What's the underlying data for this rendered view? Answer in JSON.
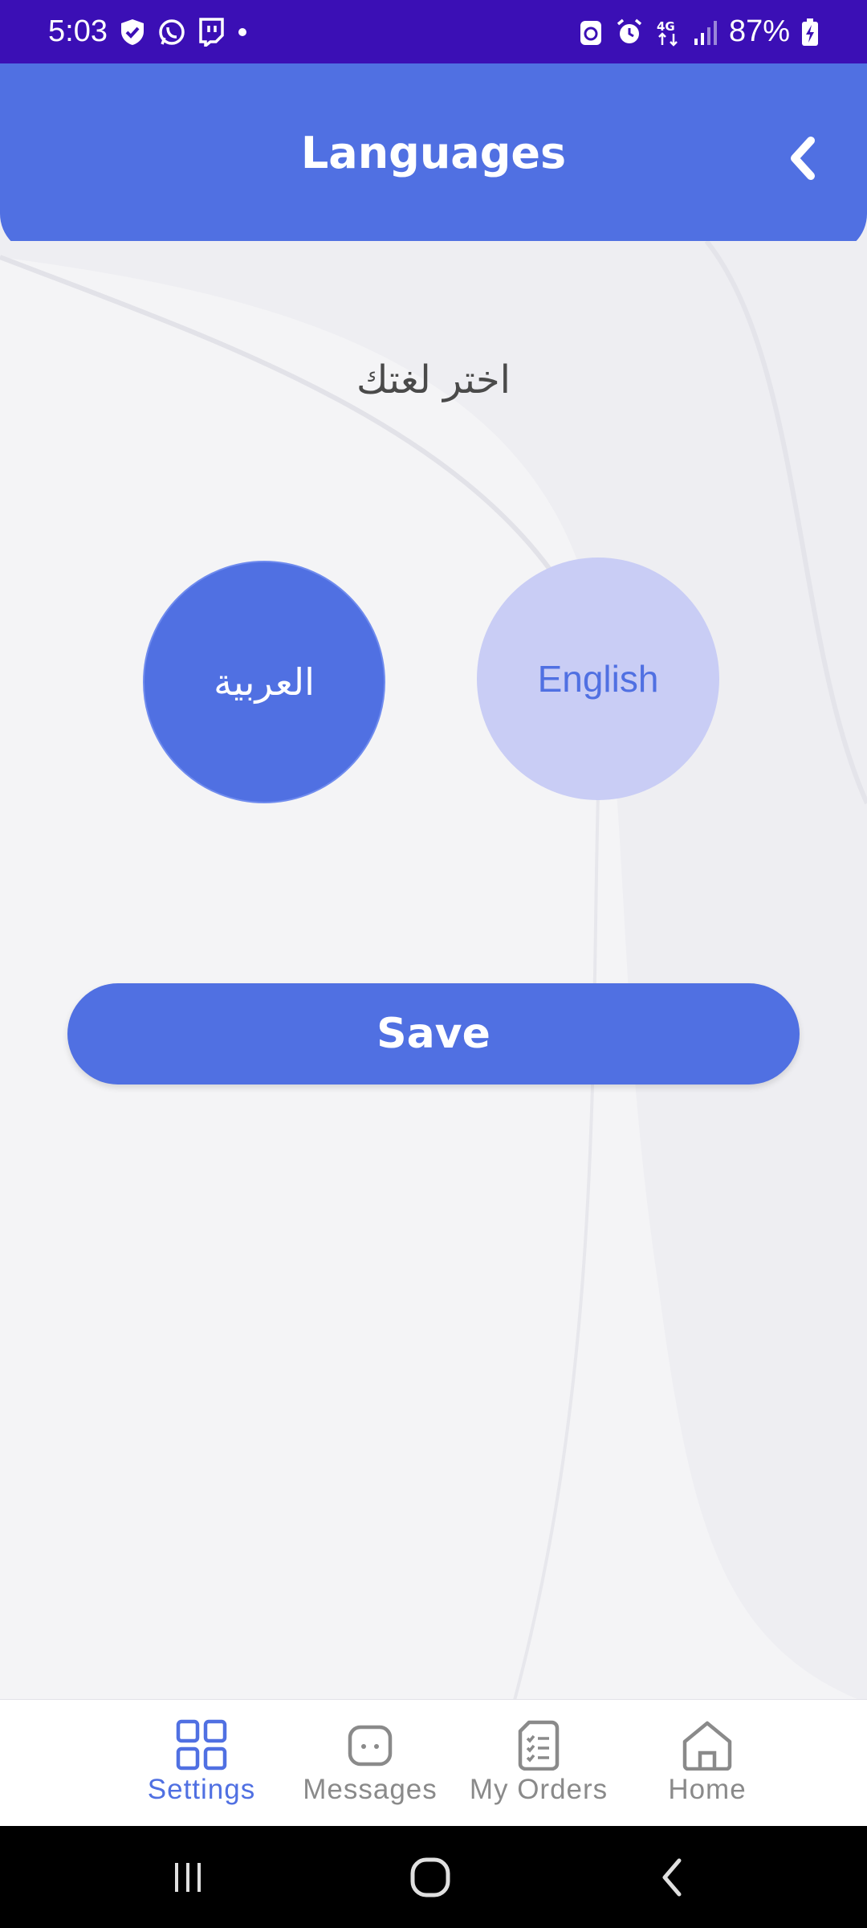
{
  "status_bar": {
    "time": "5:03",
    "battery_percent": "87%",
    "network_label": "4G",
    "icons_left": [
      "shield-icon",
      "whatsapp-icon",
      "twitch-icon",
      "dot-icon"
    ],
    "icons_right": [
      "recycle-icon",
      "alarm-icon",
      "network-4g-icon",
      "signal-icon",
      "battery-icon"
    ]
  },
  "header": {
    "title": "Languages",
    "back_icon": "chevron-left-icon"
  },
  "page": {
    "prompt": "اختر لغتك",
    "languages": [
      {
        "label": "العربية",
        "selected": true
      },
      {
        "label": "English",
        "selected": false
      }
    ],
    "save_label": "Save"
  },
  "bottom_nav": {
    "items": [
      {
        "label": "Settings",
        "icon": "grid-icon",
        "active": true
      },
      {
        "label": "Messages",
        "icon": "chat-icon",
        "active": false
      },
      {
        "label": "My Orders",
        "icon": "orders-icon",
        "active": false
      },
      {
        "label": "Home",
        "icon": "home-icon",
        "active": false
      }
    ]
  },
  "system_nav": {
    "icons": [
      "recent-apps-icon",
      "home-circle-icon",
      "system-back-icon"
    ]
  },
  "colors": {
    "status_bar": "#3b0fb5",
    "accent": "#5070e2",
    "english_circle": "#c9cdf5",
    "background": "#eeeef2"
  }
}
